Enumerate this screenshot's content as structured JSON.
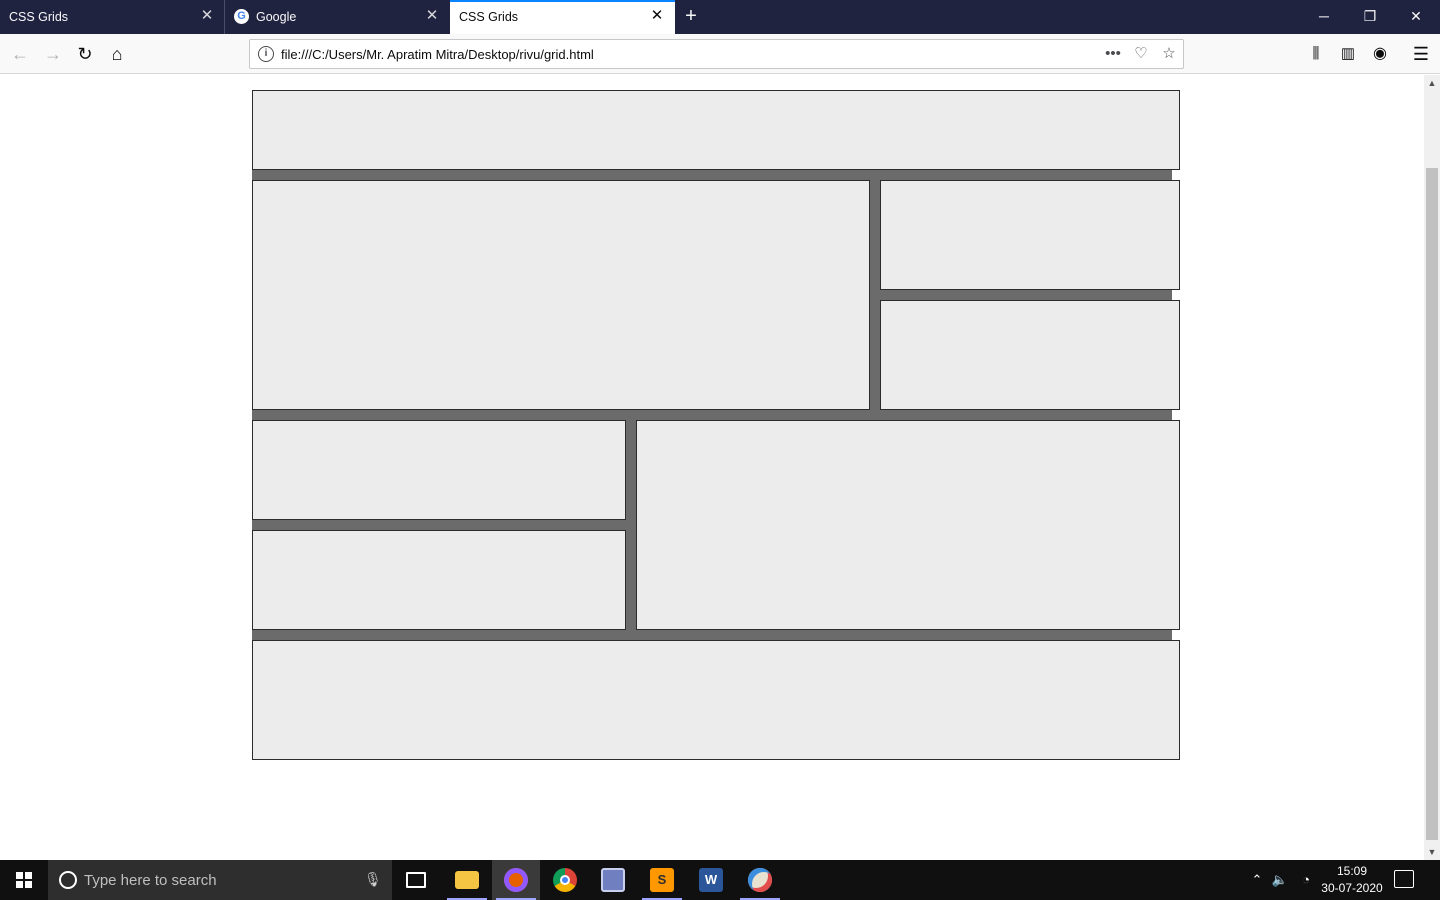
{
  "browser": {
    "tabs": [
      {
        "title": "CSS Grids",
        "active": false
      },
      {
        "title": "Google",
        "active": false
      },
      {
        "title": "CSS Grids",
        "active": true
      }
    ],
    "url": "file:///C:/Users/Mr. Apratim Mitra/Desktop/rivu/grid.html",
    "window_controls": {
      "minimize": "─",
      "restore": "❐",
      "close": "✕"
    }
  },
  "page": {
    "background": "#ffffff",
    "grid": {
      "gap_color": "#6b6b6b",
      "cell_color": "#ececec",
      "cells": [
        "header",
        "main",
        "side-1",
        "side-2",
        "left-1",
        "left-2",
        "right",
        "footer"
      ]
    }
  },
  "taskbar": {
    "search_placeholder": "Type here to search",
    "apps": [
      "file-explorer",
      "firefox",
      "chrome",
      "photo-viewer",
      "sublime-text",
      "word",
      "paint"
    ],
    "clock": {
      "time": "15:09",
      "date": "30-07-2020"
    }
  }
}
